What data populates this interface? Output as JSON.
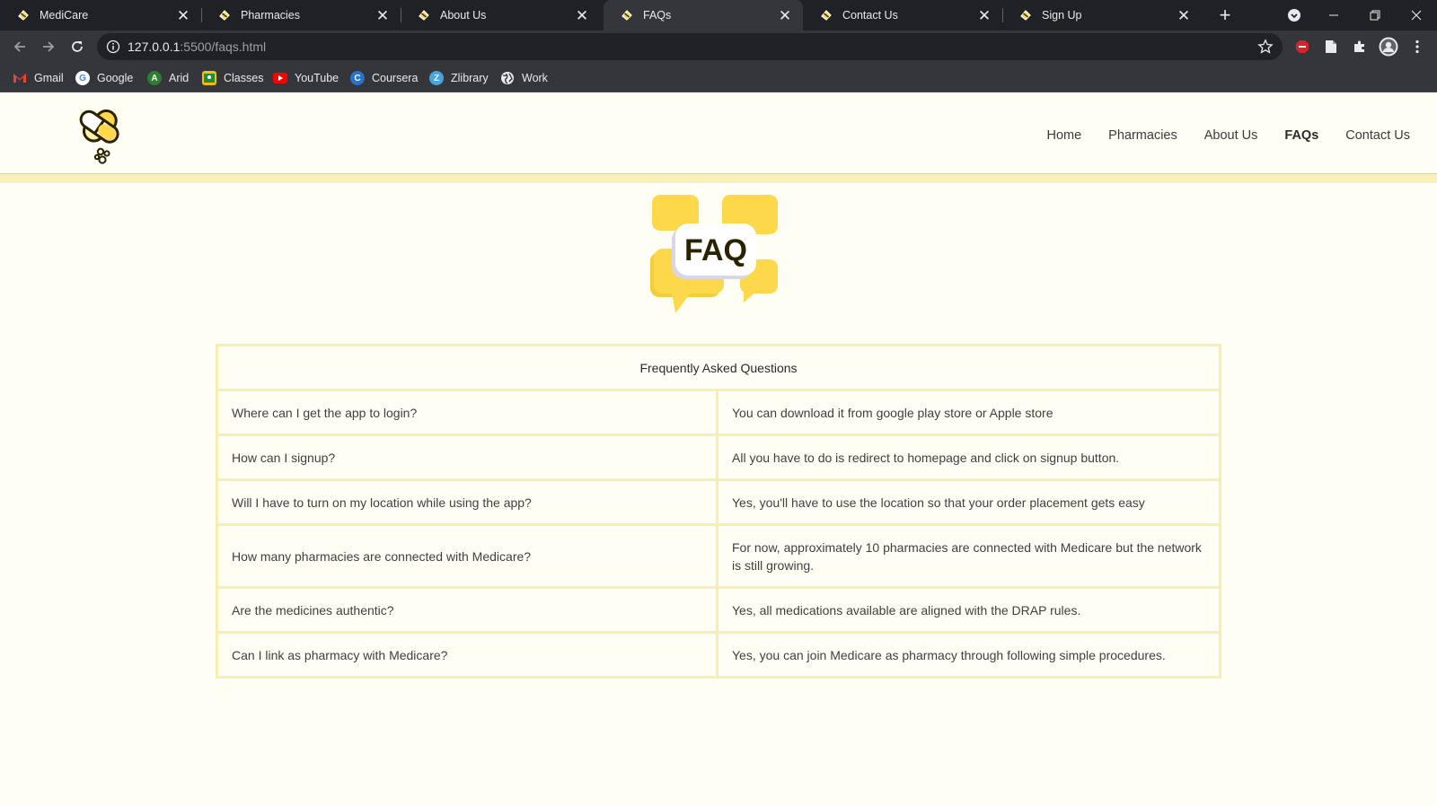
{
  "browser": {
    "tabs": [
      {
        "title": "MediCare",
        "active": false
      },
      {
        "title": "Pharmacies",
        "active": false
      },
      {
        "title": "About Us",
        "active": false
      },
      {
        "title": "FAQs",
        "active": true
      },
      {
        "title": "Contact Us",
        "active": false
      },
      {
        "title": "Sign Up",
        "active": false
      }
    ],
    "url_host": "127.0.0.1",
    "url_path": ":5500/faqs.html",
    "bookmarks": [
      {
        "label": "Gmail",
        "icon": "gmail-icon"
      },
      {
        "label": "Google",
        "icon": "google-icon"
      },
      {
        "label": "Arid",
        "icon": "arid-icon"
      },
      {
        "label": "Classes",
        "icon": "classes-icon"
      },
      {
        "label": "YouTube",
        "icon": "youtube-icon"
      },
      {
        "label": "Coursera",
        "icon": "coursera-icon"
      },
      {
        "label": "Zlibrary",
        "icon": "zlibrary-icon"
      },
      {
        "label": "Work",
        "icon": "globe-icon"
      }
    ]
  },
  "site": {
    "nav": [
      "Home",
      "Pharmacies",
      "About Us",
      "FAQs",
      "Contact Us"
    ],
    "active_nav": "FAQs",
    "faq_graphic_text": "FAQ",
    "table": {
      "header": "Frequently Asked Questions",
      "rows": [
        {
          "q": "Where can I get the app to login?",
          "a": "You can download it from google play store or Apple store"
        },
        {
          "q": "How can I signup?",
          "a": "All you have to do is redirect to homepage and click on signup button."
        },
        {
          "q": "Will I have to turn on my location while using the app?",
          "a": "Yes, you'll have to use the location so that your order placement gets easy"
        },
        {
          "q": "How many pharmacies are connected with Medicare?",
          "a": "For now, approximately 10 pharmacies are connected with Medicare but the network is still growing."
        },
        {
          "q": "Are the medicines authentic?",
          "a": "Yes, all medications available are aligned with the DRAP rules."
        },
        {
          "q": "Can I link as pharmacy with Medicare?",
          "a": "Yes, you can join Medicare as pharmacy through following simple procedures."
        }
      ]
    }
  },
  "colors": {
    "accent_yellow": "#f7f0b8",
    "brand_yellow": "#fcd84a",
    "page_bg": "#fffef5"
  }
}
